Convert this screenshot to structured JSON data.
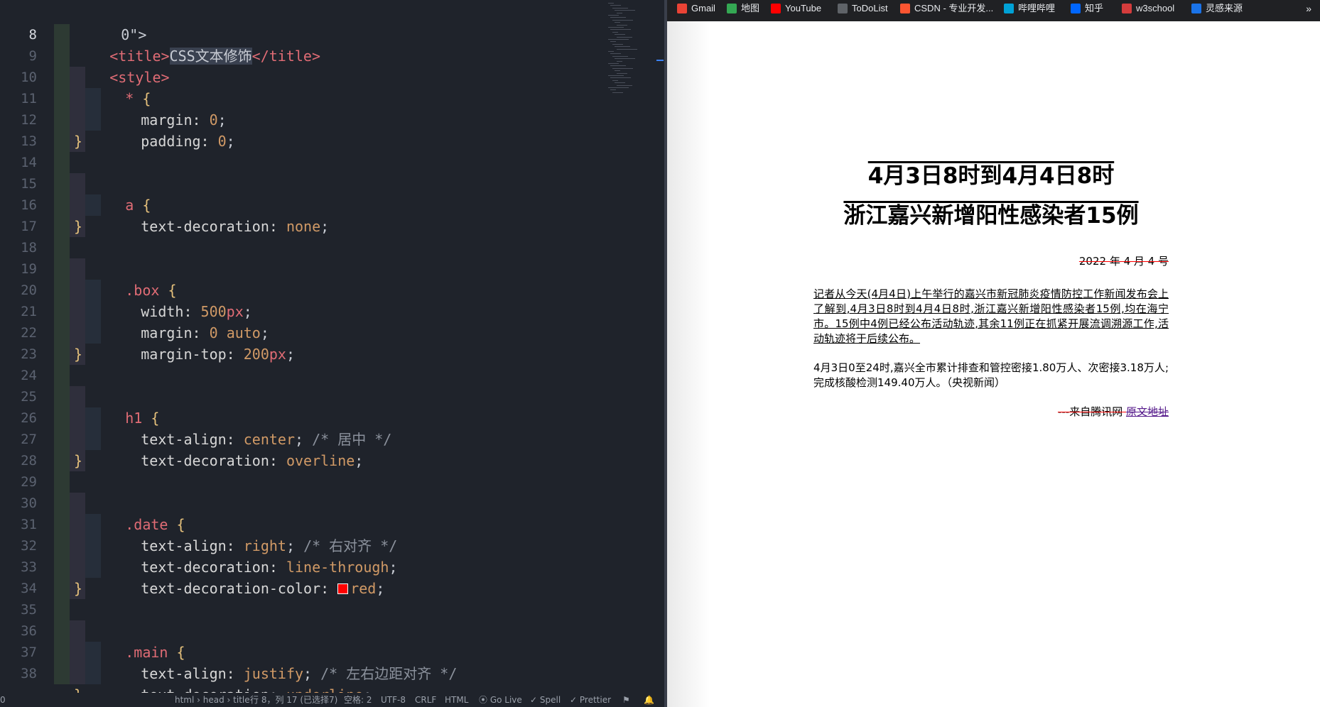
{
  "editor": {
    "active_line": "8",
    "line_numbers": [
      "8",
      "9",
      "10",
      "11",
      "12",
      "13",
      "14",
      "15",
      "16",
      "17",
      "18",
      "19",
      "20",
      "21",
      "22",
      "23",
      "24",
      "25",
      "26",
      "27",
      "28",
      "29",
      "30",
      "31",
      "32",
      "33",
      "34",
      "35",
      "36",
      "37",
      "38"
    ],
    "partial_top": "0\">",
    "lines": {
      "l8_open": "<title>",
      "l8_text": "CSS文本修饰",
      "l8_close": "</title>",
      "l9": "<style>",
      "l10_sel": "*",
      "l11_prop": "margin:",
      "l11_val": "0",
      "l12_prop": "padding:",
      "l12_val": "0",
      "l15_sel": "a",
      "l16_prop": "text-decoration:",
      "l16_val": "none",
      "l19_sel": ".box",
      "l20_prop": "width:",
      "l20_num": "500",
      "l20_unit": "px",
      "l21_prop": "margin:",
      "l21_num": "0",
      "l21_kw": "auto",
      "l22_prop": "margin-top:",
      "l22_num": "200",
      "l22_unit": "px",
      "l25_sel": "h1",
      "l26_prop": "text-align:",
      "l26_val": "center",
      "l26_cmt": "/* 居中 */",
      "l27_prop": "text-decoration:",
      "l27_val": "overline",
      "l30_sel": ".date",
      "l31_prop": "text-align:",
      "l31_val": "right",
      "l31_cmt": "/* 右对齐 */",
      "l32_prop": "text-decoration:",
      "l32_val": "line-through",
      "l33_prop": "text-decoration-color:",
      "l33_val": "red",
      "l36_sel": ".main",
      "l37_prop": "text-align:",
      "l37_val": "justify",
      "l37_cmt": "/* 左右边距对齐 */",
      "l38_prop": "text-decoration:",
      "l38_val": "underline"
    },
    "statusbar": {
      "left": "0",
      "breadcrumb": "html › head › title",
      "position": "行 8，列 17 (已选择7)",
      "indent": "空格: 2",
      "encoding": "UTF-8",
      "eol": "CRLF",
      "language": "HTML",
      "golive": "Go Live",
      "spell": "Spell",
      "prettier": "Prettier"
    }
  },
  "browser": {
    "bookmarks": [
      {
        "label": "Gmail",
        "icon": "gmail-icon",
        "color": "#ea4335"
      },
      {
        "label": "地图",
        "icon": "maps-icon",
        "color": "#34a853"
      },
      {
        "label": "YouTube",
        "icon": "youtube-icon",
        "color": "#ff0000"
      },
      {
        "label": "ToDoList",
        "icon": "todolist-icon",
        "color": "#5f6368"
      },
      {
        "label": "CSDN - 专业开发...",
        "icon": "csdn-icon",
        "color": "#fc5531"
      },
      {
        "label": "哔哩哔哩",
        "icon": "bilibili-icon",
        "color": "#00a1d6"
      },
      {
        "label": "知乎",
        "icon": "zhihu-icon",
        "color": "#0066ff"
      },
      {
        "label": "w3school",
        "icon": "w3school-icon",
        "color": "#d43c3c"
      },
      {
        "label": "灵感来源",
        "icon": "inspiration-icon",
        "color": "#1a73e8"
      }
    ],
    "more": "»",
    "page": {
      "title_line1": "4月3日8时到4月4日8时",
      "title_line2": "浙江嘉兴新增阳性感染者15例",
      "date": "2022 年 4 月 4 号",
      "para1": "记者从今天(4月4日)上午举行的嘉兴市新冠肺炎疫情防控工作新闻发布会上了解到,4月3日8时到4月4日8时,浙江嘉兴新增阳性感染者15例,均在海宁市。15例中4例已经公布活动轨迹,其余11例正在抓紧开展流调溯源工作,活动轨迹将于后续公布。",
      "para2": "4月3日0至24时,嘉兴全市累计排查和管控密接1.80万人、次密接3.18万人;完成核酸检测149.40万人。（央视新闻）",
      "source_prefix": "---来自腾讯网",
      "source_link": "原文地址"
    }
  }
}
